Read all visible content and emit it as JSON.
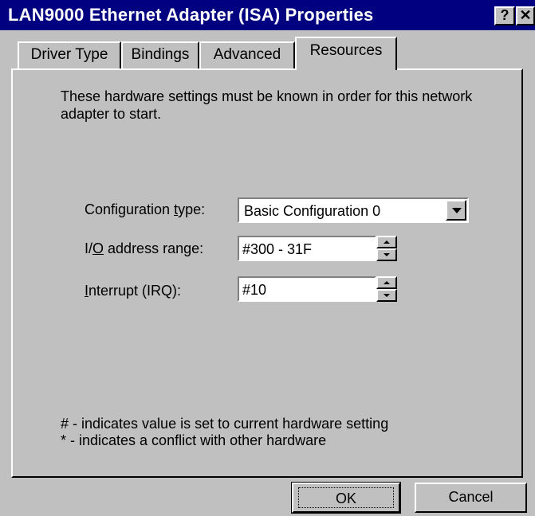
{
  "window": {
    "title": "LAN9000 Ethernet Adapter (ISA) Properties",
    "help_glyph": "?",
    "close_glyph": "✕"
  },
  "tabs": [
    {
      "label": "Driver Type",
      "active": false
    },
    {
      "label": "Bindings",
      "active": false
    },
    {
      "label": "Advanced",
      "active": false
    },
    {
      "label": "Resources",
      "active": true
    }
  ],
  "resources": {
    "description": "These hardware settings must be known in order for this network adapter to start.",
    "config_type": {
      "label_pre": "Configuration ",
      "label_key": "t",
      "label_post": "ype:",
      "value": "Basic Configuration 0"
    },
    "io_range": {
      "label_pre": "I/",
      "label_key": "O",
      "label_post": " address range:",
      "value": "#300 - 31F"
    },
    "irq": {
      "label_pre": "",
      "label_key": "I",
      "label_post": "nterrupt (IRQ):",
      "value": "#10"
    },
    "note_current": "# - indicates value is set to current hardware setting",
    "note_conflict": "* - indicates a conflict with other hardware"
  },
  "buttons": {
    "ok": "OK",
    "cancel": "Cancel"
  },
  "colors": {
    "titlebar": "#000080",
    "face": "#c0c0c0"
  }
}
